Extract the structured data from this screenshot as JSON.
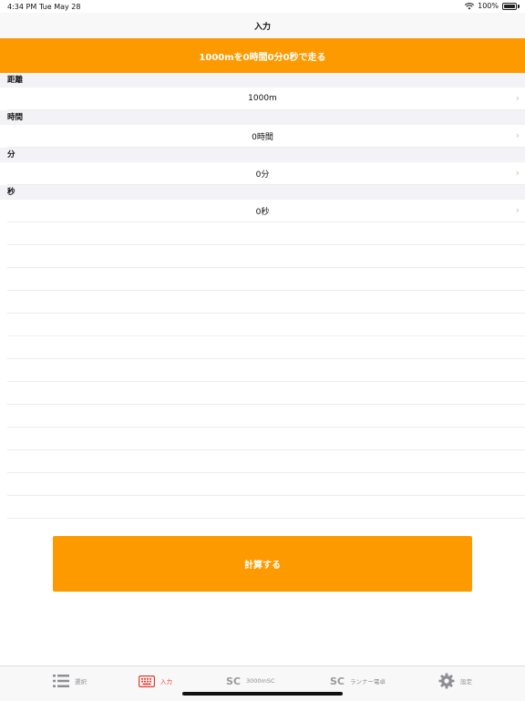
{
  "status": {
    "time": "4:34 PM",
    "date": "Tue May 28",
    "battery": "100%"
  },
  "nav": {
    "title": "入力"
  },
  "banner": {
    "text": "1000mを0時間0分0秒で走る"
  },
  "sections": [
    {
      "header": "距離",
      "value": "1000m"
    },
    {
      "header": "時間",
      "value": "0時間"
    },
    {
      "header": "分",
      "value": "0分"
    },
    {
      "header": "秒",
      "value": "0秒"
    }
  ],
  "calculate_label": "計算する",
  "tabs": [
    {
      "label": "選択",
      "icon": "list-icon"
    },
    {
      "label": "入力",
      "icon": "keyboard-icon"
    },
    {
      "label": "3000mSC",
      "icon": "sc-icon",
      "glyph": "SC"
    },
    {
      "label": "ランナー電卓",
      "icon": "sc-icon",
      "glyph": "SC"
    },
    {
      "label": "設定",
      "icon": "gear-icon"
    }
  ],
  "colors": {
    "accent": "#fd9a00",
    "active_tab": "#e63a2e"
  }
}
